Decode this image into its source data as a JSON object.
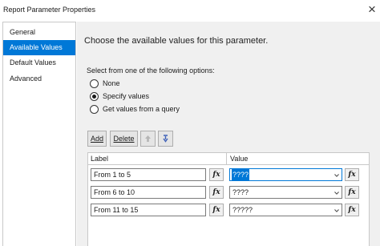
{
  "window": {
    "title": "Report Parameter Properties",
    "close_glyph": "×"
  },
  "sidebar": {
    "items": [
      {
        "label": "General",
        "active": false
      },
      {
        "label": "Available Values",
        "active": true
      },
      {
        "label": "Default Values",
        "active": false
      },
      {
        "label": "Advanced",
        "active": false
      }
    ]
  },
  "main": {
    "heading": "Choose the available values for this parameter.",
    "options_label": "Select from one of the following options:",
    "options": [
      {
        "label": "None",
        "selected": false
      },
      {
        "label": "Specify values",
        "selected": true
      },
      {
        "label": "Get values from a query",
        "selected": false
      }
    ]
  },
  "toolbar": {
    "add_label": "Add",
    "delete_label": "Delete",
    "move_up_icon": "arrow-up-icon",
    "move_down_icon": "arrow-down-icon"
  },
  "grid": {
    "columns": [
      "Label",
      "Value"
    ],
    "fx_glyph": "fx",
    "rows": [
      {
        "label": "From 1 to 5",
        "value": "????"
      },
      {
        "label": "From 6 to 10",
        "value": "????"
      },
      {
        "label": "From 11 to 15",
        "value": "?????"
      }
    ]
  },
  "colors": {
    "accent": "#0078d7",
    "panel": "#f0f0f0",
    "border": "#c8c8c8"
  }
}
